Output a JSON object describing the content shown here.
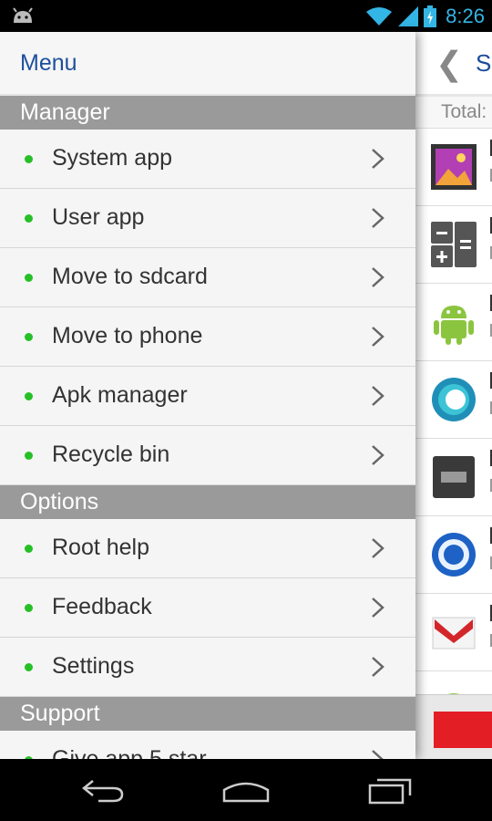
{
  "status_bar": {
    "time": "8:26"
  },
  "drawer": {
    "title": "Menu",
    "sections": [
      {
        "title": "Manager",
        "items": [
          {
            "label": "System app"
          },
          {
            "label": "User app"
          },
          {
            "label": "Move to sdcard"
          },
          {
            "label": "Move to phone"
          },
          {
            "label": "Apk manager"
          },
          {
            "label": "Recycle bin"
          }
        ]
      },
      {
        "title": "Options",
        "items": [
          {
            "label": "Root help"
          },
          {
            "label": "Feedback"
          },
          {
            "label": "Settings"
          }
        ]
      },
      {
        "title": "Support",
        "items": [
          {
            "label": "Give app 5 star"
          }
        ]
      }
    ]
  },
  "behind_screen": {
    "title": "S",
    "total_label": "Total:",
    "app_icons": [
      "gallery-icon",
      "calculator-icon",
      "android-icon",
      "ring-app-icon",
      "keyboard-icon",
      "earth-icon",
      "gmail-icon",
      "android-icon"
    ]
  },
  "colors": {
    "accent": "#1e4f9c",
    "section": "#9a9a9a",
    "dot": "#26c026",
    "status_time": "#33b5e5"
  }
}
